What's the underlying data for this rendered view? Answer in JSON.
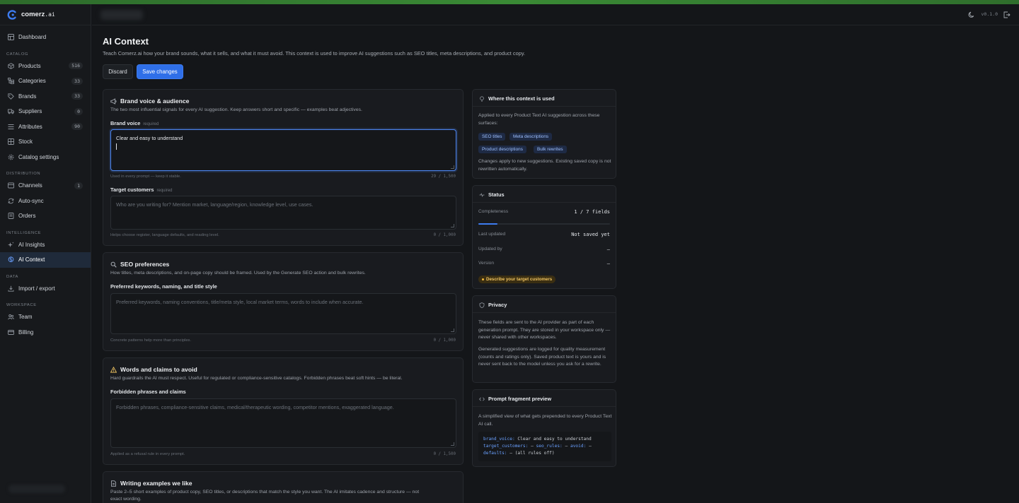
{
  "app": {
    "logo_name": "comerz",
    "logo_tld": ".ai",
    "version": "v0.1.0"
  },
  "sidebar": {
    "dashboard": "Dashboard",
    "sections": {
      "catalog": "CATALOG",
      "distribution": "DISTRIBUTION",
      "intelligence": "INTELLIGENCE",
      "data": "DATA",
      "workspace": "WORKSPACE"
    },
    "catalog_items": [
      {
        "label": "Products",
        "count": "516"
      },
      {
        "label": "Categories",
        "count": "33"
      },
      {
        "label": "Brands",
        "count": "33"
      },
      {
        "label": "Suppliers",
        "count": "0"
      },
      {
        "label": "Attributes",
        "count": "90"
      },
      {
        "label": "Stock"
      },
      {
        "label": "Catalog settings"
      }
    ],
    "distribution_items": [
      {
        "label": "Channels",
        "count": "1"
      },
      {
        "label": "Auto-sync"
      },
      {
        "label": "Orders"
      }
    ],
    "intelligence_items": [
      {
        "label": "AI Insights"
      },
      {
        "label": "AI Context"
      }
    ],
    "data_items": [
      {
        "label": "Import / export"
      }
    ],
    "workspace_items": [
      {
        "label": "Team"
      },
      {
        "label": "Billing"
      }
    ]
  },
  "page": {
    "title": "AI Context",
    "description": "Teach Comerz.ai how your brand sounds, what it sells, and what it must avoid. This context is used to improve AI suggestions such as SEO titles, meta descriptions, and product copy.",
    "discard_label": "Discard",
    "save_label": "Save changes"
  },
  "brand_card": {
    "title": "Brand voice & audience",
    "subtitle": "The two most influential signals for every AI suggestion. Keep answers short and specific — examples beat adjectives.",
    "voice_label": "Brand voice",
    "required": "required",
    "voice_value": "Clear and easy to understand",
    "voice_hint": "Used in every prompt — keep it stable.",
    "voice_counter": "29 / 1,500",
    "customers_label": "Target customers",
    "customers_placeholder": "Who are you writing for? Mention market, language/region, knowledge level, use cases.",
    "customers_hint": "Helps choose register, language defaults, and reading level.",
    "customers_counter": "0 / 1,000"
  },
  "seo_card": {
    "title": "SEO preferences",
    "subtitle": "How titles, meta descriptions, and on-page copy should be framed. Used by the Generate SEO action and bulk rewrites.",
    "label": "Preferred keywords, naming, and title style",
    "placeholder": "Preferred keywords, naming conventions, title/meta style, local market terms, words to include when accurate.",
    "hint": "Concrete patterns help more than principles.",
    "counter": "0 / 1,000"
  },
  "avoid_card": {
    "title": "Words and claims to avoid",
    "subtitle": "Hard guardrails the AI must respect. Useful for regulated or compliance-sensitive catalogs. Forbidden phrases beat soft hints — be literal.",
    "label": "Forbidden phrases and claims",
    "placeholder": "Forbidden phrases, compliance-sensitive claims, medical/therapeutic wording, competitor mentions, exaggerated language.",
    "hint": "Applied as a refusal rule in every prompt.",
    "counter": "0 / 1,500"
  },
  "examples_card": {
    "title": "Writing examples we like",
    "subtitle_line1": "Paste 2–5 short examples of product copy, SEO titles, or descriptions that match the style you want. The AI imitates cadence and structure — not",
    "subtitle_line2": "exact wording."
  },
  "where_used": {
    "title": "Where this context is used",
    "text": "Applied to every Product Text AI suggestion across these surfaces:",
    "tags": [
      "SEO titles",
      "Meta descriptions",
      "Product descriptions",
      "Bulk rewrites"
    ],
    "note": "Changes apply to new suggestions. Existing saved copy is not rewritten automatically."
  },
  "status": {
    "title": "Status",
    "completeness_label": "Completeness",
    "completeness_value": "1 / 7 fields",
    "completeness_fraction": 0.143,
    "last_updated_label": "Last updated",
    "last_updated_value": "Not saved yet",
    "updated_by_label": "Updated by",
    "updated_by_value": "—",
    "version_label": "Version",
    "version_value": "—",
    "warning": "Describe your target customers"
  },
  "privacy": {
    "title": "Privacy",
    "p1": "These fields are sent to the AI provider as part of each generation prompt. They are stored in your workspace only — never shared with other workspaces.",
    "p2": "Generated suggestions are logged for quality measurement (counts and ratings only). Saved product text is yours and is never sent back to the model unless you ask for a rewrite."
  },
  "prompt_preview": {
    "title": "Prompt fragment preview",
    "text": "A simplified view of what gets prepended to every Product Text AI call.",
    "line1_key": "brand_voice:",
    "line1_val": " Clear and easy to understand",
    "line2_k1": "target_customers:",
    "line2_v1": " — ",
    "line2_k2": "seo_rules:",
    "line2_v2": " — ",
    "line2_k3": "avoid:",
    "line2_v3": " —",
    "line3_key": "defaults:",
    "line3_val": " — (all rules off)"
  }
}
